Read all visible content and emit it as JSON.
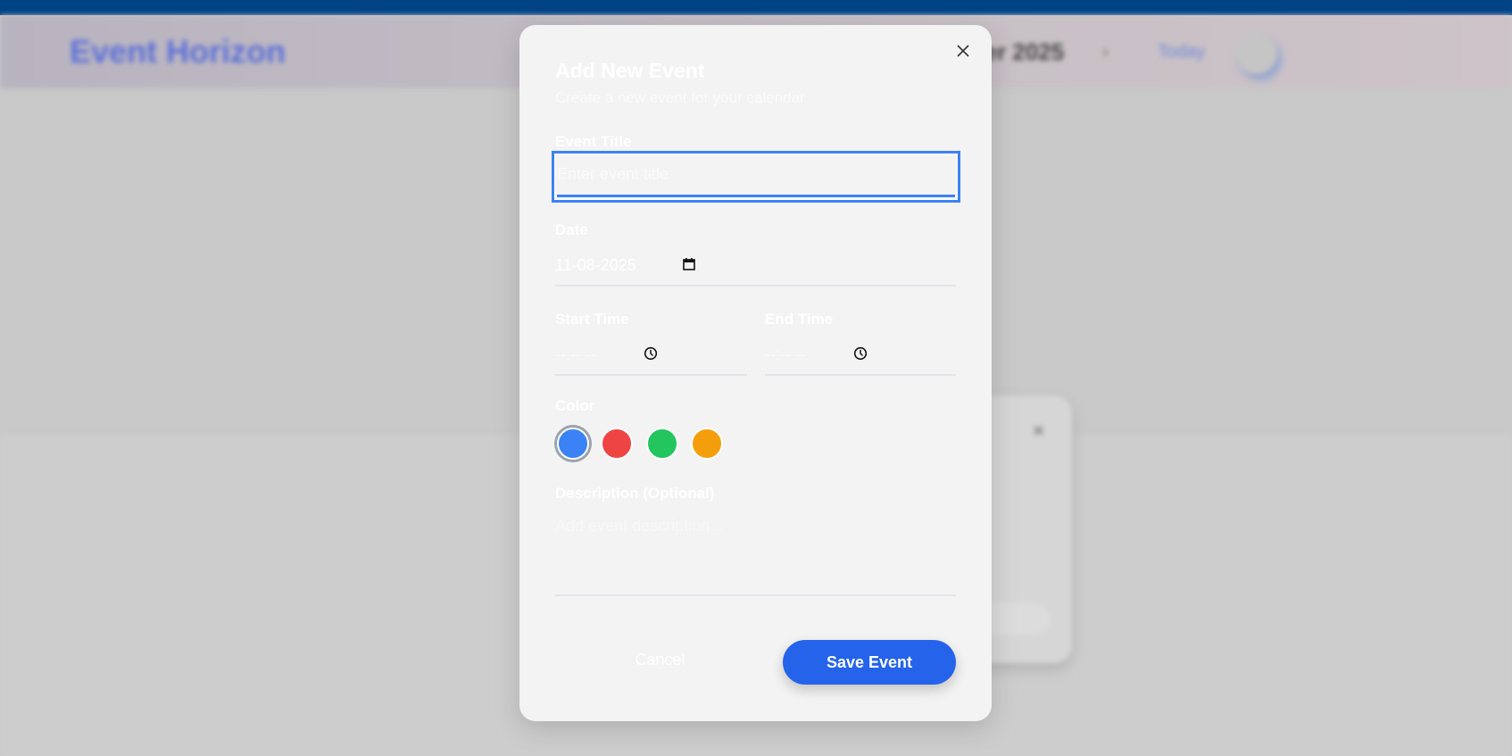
{
  "background": {
    "app_name": "Event Horizon",
    "month_label": "November 2025",
    "next_icon": "chevron-right-icon",
    "today_label": "Today"
  },
  "modal": {
    "title": "Add New Event",
    "subtitle": "Create a new event for your calendar",
    "close_icon": "close-icon",
    "event_title": {
      "label": "Event Title",
      "placeholder": "Enter event title",
      "value": ""
    },
    "date": {
      "label": "Date",
      "value": "11-08-2025",
      "icon": "calendar-icon"
    },
    "start_time": {
      "label": "Start Time",
      "value": "--:-- --",
      "icon": "clock-icon"
    },
    "end_time": {
      "label": "End Time",
      "value": "--:-- --",
      "icon": "clock-icon"
    },
    "color": {
      "label": "Color",
      "options": [
        "#3b82f6",
        "#ef4444",
        "#22c55e",
        "#f59e0b"
      ],
      "selected": "#3b82f6"
    },
    "description": {
      "label": "Description (Optional)",
      "placeholder": "Add event description..."
    },
    "cancel_label": "Cancel",
    "save_label": "Save Event"
  },
  "colors": {
    "top_bar": "#004385",
    "accent": "#2563eb",
    "focus": "#3b82f6"
  }
}
